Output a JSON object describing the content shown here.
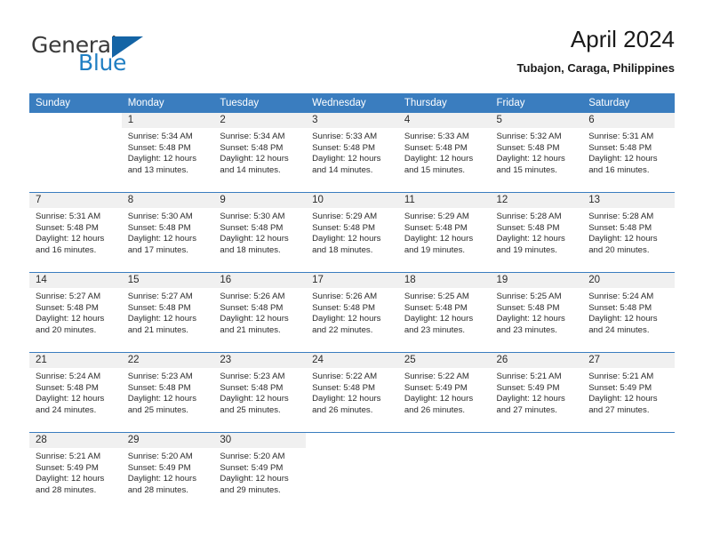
{
  "logo": {
    "word_top": "General",
    "word_bottom": "Blue",
    "triangle_color": "#1464a5",
    "blue_color": "#1f7ec2"
  },
  "header": {
    "title": "April 2024",
    "subtitle": "Tubajon, Caraga, Philippines",
    "accent_color": "#3a7dbf",
    "band_color": "#f0f0f0"
  },
  "weekday_headers": [
    "Sunday",
    "Monday",
    "Tuesday",
    "Wednesday",
    "Thursday",
    "Friday",
    "Saturday"
  ],
  "weeks": [
    [
      {
        "day": "",
        "blank": true,
        "sunrise": "",
        "sunset": "",
        "daylight_line1": "",
        "daylight_line2": ""
      },
      {
        "day": "1",
        "sunrise": "Sunrise: 5:34 AM",
        "sunset": "Sunset: 5:48 PM",
        "daylight_line1": "Daylight: 12 hours",
        "daylight_line2": "and 13 minutes."
      },
      {
        "day": "2",
        "sunrise": "Sunrise: 5:34 AM",
        "sunset": "Sunset: 5:48 PM",
        "daylight_line1": "Daylight: 12 hours",
        "daylight_line2": "and 14 minutes."
      },
      {
        "day": "3",
        "sunrise": "Sunrise: 5:33 AM",
        "sunset": "Sunset: 5:48 PM",
        "daylight_line1": "Daylight: 12 hours",
        "daylight_line2": "and 14 minutes."
      },
      {
        "day": "4",
        "sunrise": "Sunrise: 5:33 AM",
        "sunset": "Sunset: 5:48 PM",
        "daylight_line1": "Daylight: 12 hours",
        "daylight_line2": "and 15 minutes."
      },
      {
        "day": "5",
        "sunrise": "Sunrise: 5:32 AM",
        "sunset": "Sunset: 5:48 PM",
        "daylight_line1": "Daylight: 12 hours",
        "daylight_line2": "and 15 minutes."
      },
      {
        "day": "6",
        "sunrise": "Sunrise: 5:31 AM",
        "sunset": "Sunset: 5:48 PM",
        "daylight_line1": "Daylight: 12 hours",
        "daylight_line2": "and 16 minutes."
      }
    ],
    [
      {
        "day": "7",
        "sunrise": "Sunrise: 5:31 AM",
        "sunset": "Sunset: 5:48 PM",
        "daylight_line1": "Daylight: 12 hours",
        "daylight_line2": "and 16 minutes."
      },
      {
        "day": "8",
        "sunrise": "Sunrise: 5:30 AM",
        "sunset": "Sunset: 5:48 PM",
        "daylight_line1": "Daylight: 12 hours",
        "daylight_line2": "and 17 minutes."
      },
      {
        "day": "9",
        "sunrise": "Sunrise: 5:30 AM",
        "sunset": "Sunset: 5:48 PM",
        "daylight_line1": "Daylight: 12 hours",
        "daylight_line2": "and 18 minutes."
      },
      {
        "day": "10",
        "sunrise": "Sunrise: 5:29 AM",
        "sunset": "Sunset: 5:48 PM",
        "daylight_line1": "Daylight: 12 hours",
        "daylight_line2": "and 18 minutes."
      },
      {
        "day": "11",
        "sunrise": "Sunrise: 5:29 AM",
        "sunset": "Sunset: 5:48 PM",
        "daylight_line1": "Daylight: 12 hours",
        "daylight_line2": "and 19 minutes."
      },
      {
        "day": "12",
        "sunrise": "Sunrise: 5:28 AM",
        "sunset": "Sunset: 5:48 PM",
        "daylight_line1": "Daylight: 12 hours",
        "daylight_line2": "and 19 minutes."
      },
      {
        "day": "13",
        "sunrise": "Sunrise: 5:28 AM",
        "sunset": "Sunset: 5:48 PM",
        "daylight_line1": "Daylight: 12 hours",
        "daylight_line2": "and 20 minutes."
      }
    ],
    [
      {
        "day": "14",
        "sunrise": "Sunrise: 5:27 AM",
        "sunset": "Sunset: 5:48 PM",
        "daylight_line1": "Daylight: 12 hours",
        "daylight_line2": "and 20 minutes."
      },
      {
        "day": "15",
        "sunrise": "Sunrise: 5:27 AM",
        "sunset": "Sunset: 5:48 PM",
        "daylight_line1": "Daylight: 12 hours",
        "daylight_line2": "and 21 minutes."
      },
      {
        "day": "16",
        "sunrise": "Sunrise: 5:26 AM",
        "sunset": "Sunset: 5:48 PM",
        "daylight_line1": "Daylight: 12 hours",
        "daylight_line2": "and 21 minutes."
      },
      {
        "day": "17",
        "sunrise": "Sunrise: 5:26 AM",
        "sunset": "Sunset: 5:48 PM",
        "daylight_line1": "Daylight: 12 hours",
        "daylight_line2": "and 22 minutes."
      },
      {
        "day": "18",
        "sunrise": "Sunrise: 5:25 AM",
        "sunset": "Sunset: 5:48 PM",
        "daylight_line1": "Daylight: 12 hours",
        "daylight_line2": "and 23 minutes."
      },
      {
        "day": "19",
        "sunrise": "Sunrise: 5:25 AM",
        "sunset": "Sunset: 5:48 PM",
        "daylight_line1": "Daylight: 12 hours",
        "daylight_line2": "and 23 minutes."
      },
      {
        "day": "20",
        "sunrise": "Sunrise: 5:24 AM",
        "sunset": "Sunset: 5:48 PM",
        "daylight_line1": "Daylight: 12 hours",
        "daylight_line2": "and 24 minutes."
      }
    ],
    [
      {
        "day": "21",
        "sunrise": "Sunrise: 5:24 AM",
        "sunset": "Sunset: 5:48 PM",
        "daylight_line1": "Daylight: 12 hours",
        "daylight_line2": "and 24 minutes."
      },
      {
        "day": "22",
        "sunrise": "Sunrise: 5:23 AM",
        "sunset": "Sunset: 5:48 PM",
        "daylight_line1": "Daylight: 12 hours",
        "daylight_line2": "and 25 minutes."
      },
      {
        "day": "23",
        "sunrise": "Sunrise: 5:23 AM",
        "sunset": "Sunset: 5:48 PM",
        "daylight_line1": "Daylight: 12 hours",
        "daylight_line2": "and 25 minutes."
      },
      {
        "day": "24",
        "sunrise": "Sunrise: 5:22 AM",
        "sunset": "Sunset: 5:48 PM",
        "daylight_line1": "Daylight: 12 hours",
        "daylight_line2": "and 26 minutes."
      },
      {
        "day": "25",
        "sunrise": "Sunrise: 5:22 AM",
        "sunset": "Sunset: 5:49 PM",
        "daylight_line1": "Daylight: 12 hours",
        "daylight_line2": "and 26 minutes."
      },
      {
        "day": "26",
        "sunrise": "Sunrise: 5:21 AM",
        "sunset": "Sunset: 5:49 PM",
        "daylight_line1": "Daylight: 12 hours",
        "daylight_line2": "and 27 minutes."
      },
      {
        "day": "27",
        "sunrise": "Sunrise: 5:21 AM",
        "sunset": "Sunset: 5:49 PM",
        "daylight_line1": "Daylight: 12 hours",
        "daylight_line2": "and 27 minutes."
      }
    ],
    [
      {
        "day": "28",
        "sunrise": "Sunrise: 5:21 AM",
        "sunset": "Sunset: 5:49 PM",
        "daylight_line1": "Daylight: 12 hours",
        "daylight_line2": "and 28 minutes."
      },
      {
        "day": "29",
        "sunrise": "Sunrise: 5:20 AM",
        "sunset": "Sunset: 5:49 PM",
        "daylight_line1": "Daylight: 12 hours",
        "daylight_line2": "and 28 minutes."
      },
      {
        "day": "30",
        "sunrise": "Sunrise: 5:20 AM",
        "sunset": "Sunset: 5:49 PM",
        "daylight_line1": "Daylight: 12 hours",
        "daylight_line2": "and 29 minutes."
      },
      {
        "day": "",
        "blank": true,
        "sunrise": "",
        "sunset": "",
        "daylight_line1": "",
        "daylight_line2": ""
      },
      {
        "day": "",
        "blank": true,
        "sunrise": "",
        "sunset": "",
        "daylight_line1": "",
        "daylight_line2": ""
      },
      {
        "day": "",
        "blank": true,
        "sunrise": "",
        "sunset": "",
        "daylight_line1": "",
        "daylight_line2": ""
      },
      {
        "day": "",
        "blank": true,
        "sunrise": "",
        "sunset": "",
        "daylight_line1": "",
        "daylight_line2": ""
      }
    ]
  ]
}
